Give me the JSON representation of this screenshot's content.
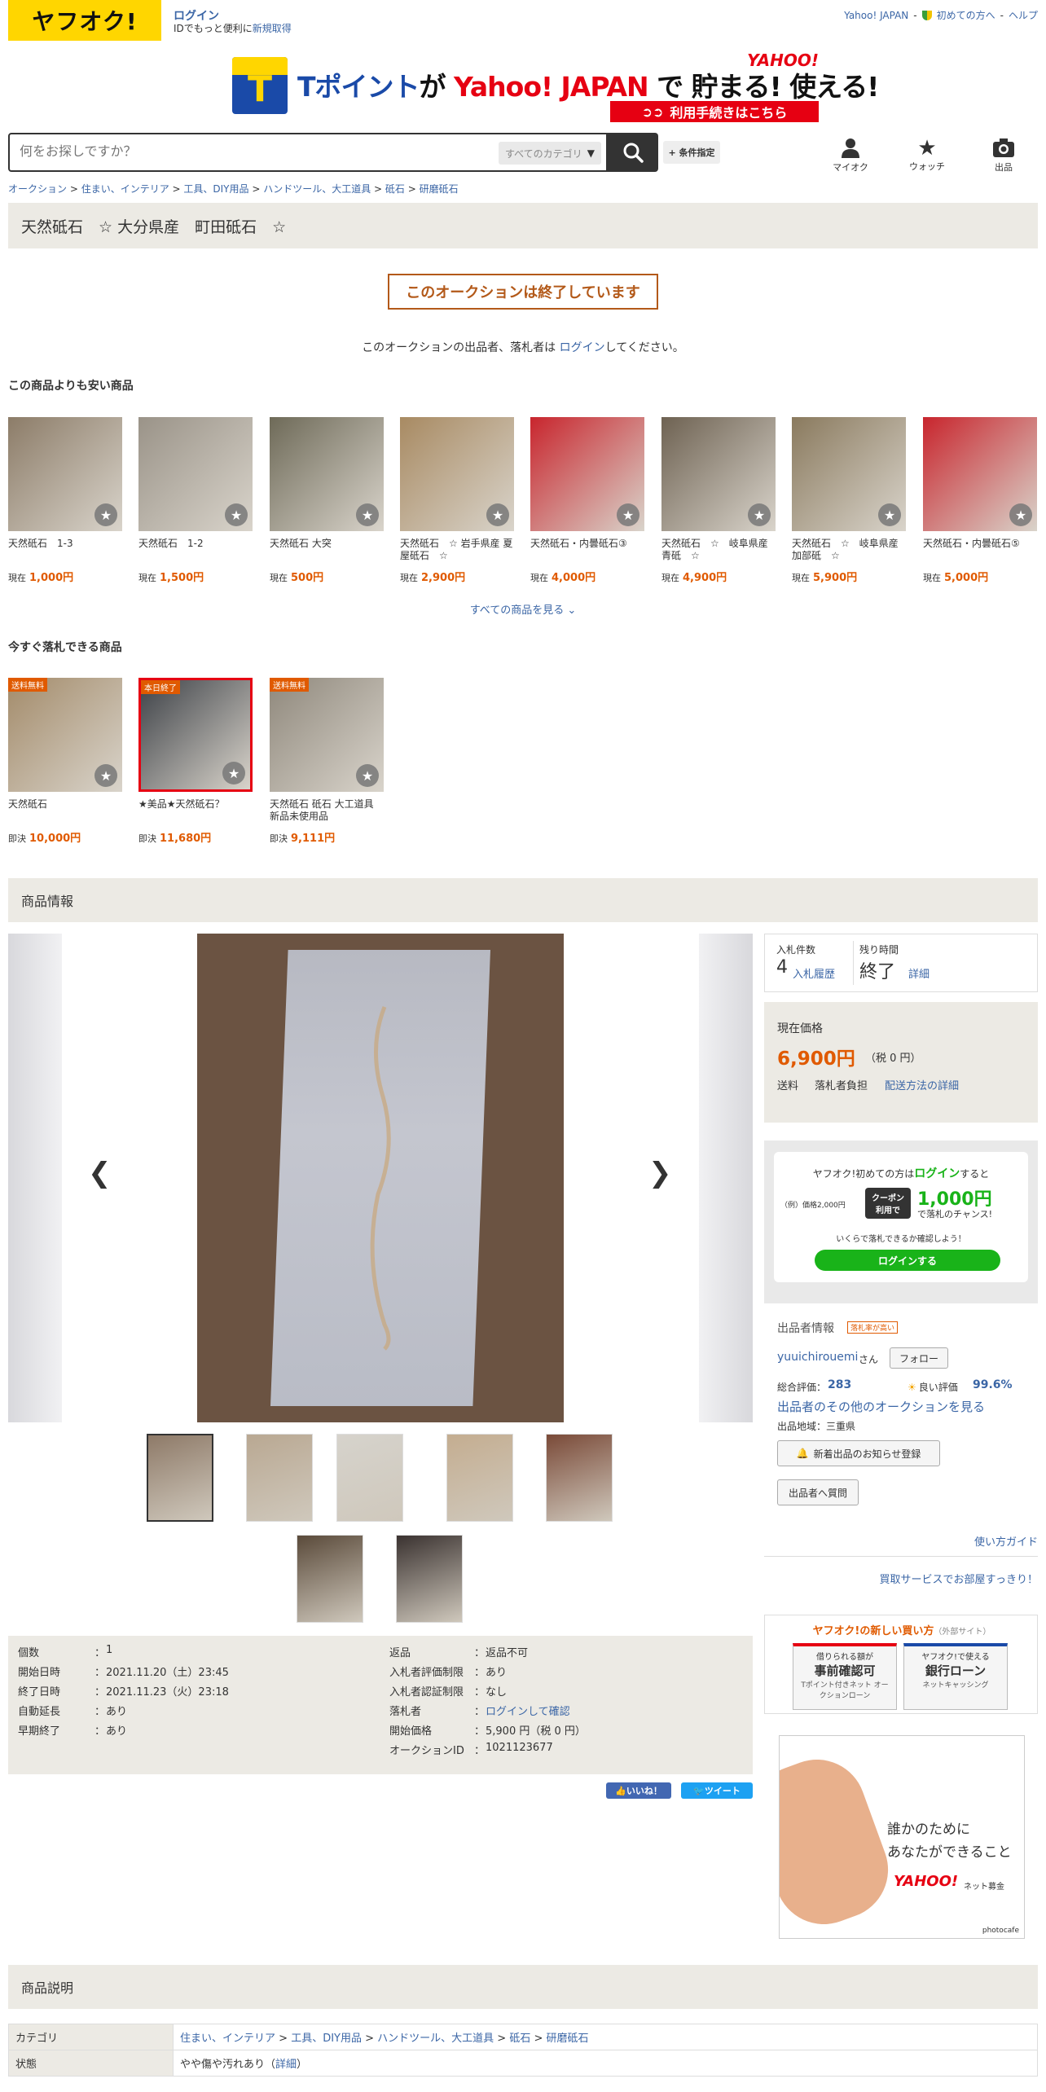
{
  "header": {
    "logo": "ヤフオク!",
    "login_label": "ログイン",
    "login_sub": "IDでもっと便利に",
    "register_label": "新規取得",
    "top_links": [
      "Yahoo! JAPAN",
      "初めての方へ",
      "ヘルプ"
    ]
  },
  "banner": {
    "t_letter": "T",
    "text_a": "Tポイント",
    "text_b": "が ",
    "text_c": "Yahoo! JAPAN",
    "text_d": " で 貯まる! 使える!",
    "yahoo": "YAHOO!",
    "button": "利用手続きはこちら"
  },
  "search": {
    "placeholder": "何をお探しですか？",
    "category": "すべてのカテゴリ",
    "condition": "+ 条件指定"
  },
  "header_icons": [
    {
      "label": "マイオク",
      "icon": "person-icon"
    },
    {
      "label": "ウォッチ",
      "icon": "star-icon"
    },
    {
      "label": "出品",
      "icon": "camera-icon"
    }
  ],
  "breadcrumb": [
    "オークション",
    "住まい、インテリア",
    "工具、DIY用品",
    "ハンドツール、大工道具",
    "砥石",
    "研磨砥石"
  ],
  "title": "天然砥石　☆ 大分県産　町田砥石　☆",
  "ended_label": "このオークションは終了しています",
  "login_note": {
    "before": "このオークションの出品者、落札者は ",
    "link": "ログイン",
    "after": "してください。"
  },
  "cheaper": {
    "heading": "この商品よりも安い商品",
    "price_prefix": "現在",
    "items": [
      {
        "name": "天然砥石　1-3",
        "price": "1,000円",
        "bg": "#8c7c68"
      },
      {
        "name": "天然砥石　1-2",
        "price": "1,500円",
        "bg": "#9a9388"
      },
      {
        "name": "天然砥石 大突",
        "price": "500円",
        "bg": "#6e6a58"
      },
      {
        "name": "天然砥石　☆ 岩手県産 夏屋砥石　☆",
        "price": "2,900円",
        "bg": "#a88a62"
      },
      {
        "name": "天然砥石・内曇砥石③",
        "price": "4,000円",
        "bg": "#c8252d"
      },
      {
        "name": "天然砥石　☆　岐阜県産 青砥　☆",
        "price": "4,900円",
        "bg": "#6e6252"
      },
      {
        "name": "天然砥石　☆　岐阜県産 加部砥　☆",
        "price": "5,900円",
        "bg": "#8a7a5e"
      },
      {
        "name": "天然砥石・内曇砥石⑤",
        "price": "5,000円",
        "bg": "#c8252d"
      }
    ],
    "see_all": "すべての商品を見る"
  },
  "buynow": {
    "heading": "今すぐ落札できる商品",
    "price_prefix": "即決",
    "items": [
      {
        "name": "天然砥石",
        "price": "10,000円",
        "tag": "送料無料",
        "bg": "#a38b6a"
      },
      {
        "name": "★美品★天然砥石？",
        "price": "11,680円",
        "tag": "本日終了",
        "bg": "#3e4248"
      },
      {
        "name": "天然砥石 砥石 大工道具 新品未使用品",
        "price": "9,111円",
        "tag": "送料無料",
        "bg": "#8f887c"
      }
    ]
  },
  "info_heading": "商品情報",
  "thumbs": [
    "#8e7a68",
    "#b9a892",
    "#d6d3cc",
    "#c4ad90",
    "#7a4a38",
    "#5a4a3a",
    "#3a3230"
  ],
  "bids": {
    "count_label": "入札件数",
    "count": "4",
    "history": "入札履歴",
    "time_label": "残り時間",
    "time": "終了",
    "detail": "詳細"
  },
  "price": {
    "label": "現在価格",
    "value": "6,900円",
    "tax": "（税 0 円）",
    "ship_label": "送料",
    "ship_value": "落札者負担",
    "ship_link": "配送方法の詳細"
  },
  "promo": {
    "line1a": "ヤフオク!初めての方は",
    "line1b": "ログイン",
    "line1c": "すると",
    "example": "（例）価格2,000円",
    "coupon": "クーポン 利用で",
    "amount": "1,000円",
    "chance": "で落札のチャンス!",
    "note": "いくらで落札できるか確認しよう！",
    "button": "ログインする"
  },
  "seller": {
    "heading": "出品者情報",
    "badge": "落札率が高い",
    "name": "yuuichirouemi",
    "san": "さん",
    "follow": "フォロー",
    "rating_label": "総合評価：",
    "rating": "283",
    "good_label": "良い評価",
    "good": "99.6%",
    "others": "出品者のその他のオークションを見る",
    "region": "出品地域：三重県",
    "notify": "新着出品のお知らせ登録",
    "question": "出品者へ質問",
    "guide": "使い方ガイド",
    "kaitori": "買取サービスでお部屋すっきり！"
  },
  "details": {
    "left": [
      {
        "k": "個数",
        "v": "1",
        "link": false
      },
      {
        "k": "開始日時",
        "v": "2021.11.20（土）23:45",
        "link": false
      },
      {
        "k": "終了日時",
        "v": "2021.11.23（火）23:18",
        "link": false
      },
      {
        "k": "自動延長",
        "v": "あり",
        "link": true
      },
      {
        "k": "早期終了",
        "v": "あり",
        "link": true
      }
    ],
    "right": [
      {
        "k": "返品",
        "v": "返品不可",
        "link": false,
        "vlink": false
      },
      {
        "k": "入札者評価制限",
        "v": "あり",
        "link": true,
        "vlink": false
      },
      {
        "k": "入札者認証制限",
        "v": "なし",
        "link": true,
        "vlink": false
      },
      {
        "k": "落札者",
        "v": "ログインして確認",
        "link": false,
        "vlink": true
      },
      {
        "k": "開始価格",
        "v": "5,900 円（税 0 円）",
        "link": false,
        "vlink": false
      },
      {
        "k": "オークションID",
        "v": "1021123677",
        "link": false,
        "vlink": false
      }
    ]
  },
  "share": {
    "like": "いいね！",
    "tweet": "ツイート"
  },
  "newbuy": {
    "title": "ヤフオク!の新しい買い方",
    "external": "（外部サイト）",
    "card1": {
      "top": "借りられる額が",
      "main": "事前確認可",
      "sub": "Tポイント付きネット オークションローン"
    },
    "card2": {
      "top": "ヤフオク!で使える",
      "main": "銀行ローン",
      "sub": "ネットキャッシング"
    }
  },
  "ad": {
    "line1": "誰かのために",
    "line2": "あなたができること",
    "brand": "YAHOO!",
    "brand_sub": "ネット募金",
    "credit": "photocafe"
  },
  "desc_heading": "商品説明",
  "desc": {
    "category_label": "カテゴリ",
    "category": [
      "住まい、インテリア",
      "工具、DIY用品",
      "ハンドツール、大工道具",
      "砥石",
      "研磨砥石"
    ],
    "state_label": "状態",
    "state": "やや傷や汚れあり",
    "state_link": "詳細"
  },
  "colors": {
    "accent": "#e05a00",
    "link": "#3b66a6",
    "ended": "#b35919",
    "yahoo_yellow": "#ffd600",
    "green": "#19b319"
  }
}
